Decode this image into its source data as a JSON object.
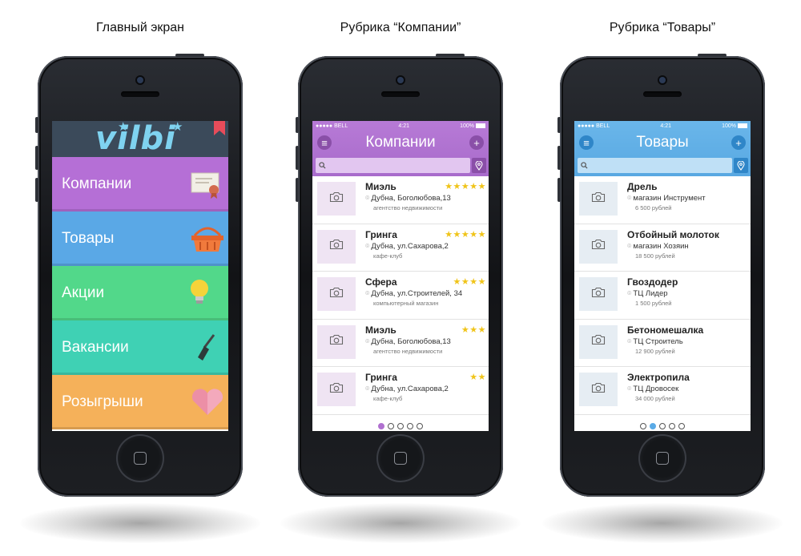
{
  "captions": {
    "main": "Главный экран",
    "companies": "Рубрика “Компании”",
    "goods": "Рубрика “Товары”"
  },
  "main_screen": {
    "logo": "vilbi",
    "colors": {
      "logo_bg": "#3b4a5a",
      "logo_text": "#7fd3f0",
      "bookmark": "#e74c5a"
    },
    "tiles": [
      {
        "label": "Компании",
        "color": "#b56fd6",
        "icon": "certificate-icon"
      },
      {
        "label": "Товары",
        "color": "#5aa8e6",
        "icon": "basket-icon"
      },
      {
        "label": "Акции",
        "color": "#52d88a",
        "icon": "lightbulb-icon"
      },
      {
        "label": "Вакансии",
        "color": "#3fd1b4",
        "icon": "screwdriver-icon"
      },
      {
        "label": "Розыгрыши",
        "color": "#f5b15a",
        "icon": "heart-icon"
      }
    ]
  },
  "companies_screen": {
    "accent": "#b070d0",
    "status": {
      "carrier": "BELL",
      "time": "4:21",
      "battery": "100%"
    },
    "title": "Компании",
    "search_placeholder": "",
    "active_page": 0,
    "pages": 5,
    "items": [
      {
        "name": "Миэль",
        "stars": "★★★★★",
        "address": "Дубна, Боголюбова,13",
        "category": "агентство недвижимости"
      },
      {
        "name": "Гринга",
        "stars": "★★★★★",
        "address": "Дубна, ул.Сахарова,2",
        "category": "кафе-клуб"
      },
      {
        "name": "Сфера",
        "stars": "★★★★",
        "address": "Дубна, ул.Строителей, 34",
        "category": "компьютерный магазин"
      },
      {
        "name": "Миэль",
        "stars": "★★★",
        "address": "Дубна, Боголюбова,13",
        "category": "агентство недвижимости"
      },
      {
        "name": "Гринга",
        "stars": "★★",
        "address": "Дубна, ул.Сахарова,2",
        "category": "кафе-клуб"
      }
    ]
  },
  "goods_screen": {
    "accent": "#5aaae6",
    "status": {
      "carrier": "BELL",
      "time": "4:21",
      "battery": "100%"
    },
    "title": "Товары",
    "search_placeholder": "",
    "active_page": 1,
    "pages": 5,
    "items": [
      {
        "name": "Дрель",
        "store": "магазин Инструмент",
        "price": "6 500 рублей"
      },
      {
        "name": "Отбойный молоток",
        "store": "магазин Хозяин",
        "price": "18 500 рублей"
      },
      {
        "name": "Гвоздодер",
        "store": "ТЦ Лидер",
        "price": "1 500 рублей"
      },
      {
        "name": "Бетономешалка",
        "store": "ТЦ Строитель",
        "price": "12 900 рублей"
      },
      {
        "name": "Электропила",
        "store": "ТЦ Дровосек",
        "price": "34 000 рублей"
      }
    ]
  }
}
